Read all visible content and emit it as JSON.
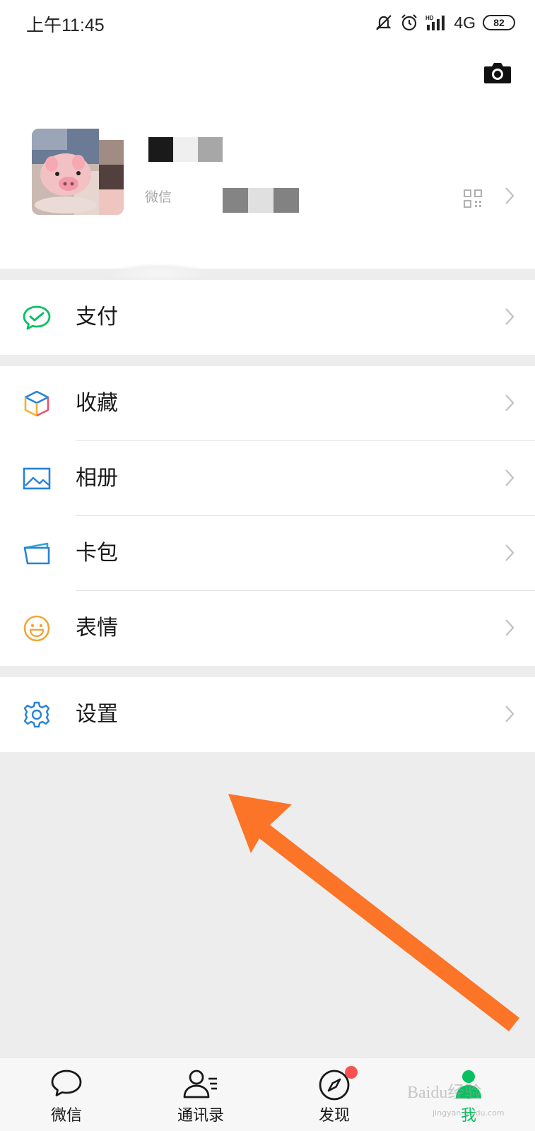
{
  "status_bar": {
    "time": "上午11:45",
    "network": "4G",
    "battery": "82",
    "icons": [
      "mute-icon",
      "alarm-icon",
      "hd-signal-icon"
    ]
  },
  "profile": {
    "wxid_label": "微信",
    "icons": [
      "camera-icon",
      "qr-code-icon",
      "chevron-right-icon"
    ]
  },
  "menu": {
    "pay": {
      "label": "支付",
      "icon": "wechat-pay-icon",
      "color": "#07c160"
    },
    "favorites": {
      "label": "收藏",
      "icon": "cube-icon"
    },
    "album": {
      "label": "相册",
      "icon": "picture-icon",
      "color": "#2782d7"
    },
    "cards": {
      "label": "卡包",
      "icon": "card-icon",
      "color": "#2782d7"
    },
    "stickers": {
      "label": "表情",
      "icon": "smiley-icon",
      "color": "#f0a63c"
    },
    "settings": {
      "label": "设置",
      "icon": "gear-icon",
      "color": "#2782d7"
    }
  },
  "tabbar": {
    "tabs": [
      {
        "label": "微信",
        "icon": "chat-bubble-icon"
      },
      {
        "label": "通讯录",
        "icon": "contacts-icon"
      },
      {
        "label": "发现",
        "icon": "compass-icon",
        "badge": true
      },
      {
        "label": "我",
        "icon": "person-icon",
        "active": true
      }
    ],
    "active_color": "#07c160"
  },
  "overlay": {
    "watermark": "Baidu经验",
    "watermark_sub": "jingyan.baidu.com",
    "arrow_color": "#fb7427"
  }
}
